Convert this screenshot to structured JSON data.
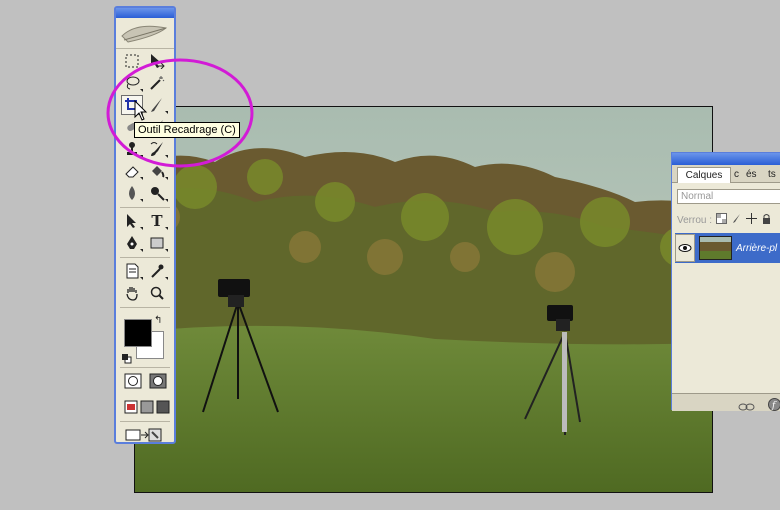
{
  "tooltip": {
    "text": "Outil Recadrage (C)"
  },
  "layers_panel": {
    "tabs": [
      "Calques",
      "c",
      "és",
      "ts"
    ],
    "blend_mode": "Normal",
    "lock_label": "Verrou :",
    "layer_name": "Arrière-pl"
  },
  "toolbox": {
    "type_tool_glyph": "T",
    "tools": [
      "marquee-tool",
      "move-tool",
      "lasso-tool",
      "magic-wand-tool",
      "crop-tool",
      "slice-tool",
      "healing-brush-tool",
      "brush-tool",
      "clone-stamp-tool",
      "history-brush-tool",
      "eraser-tool",
      "paint-bucket-tool",
      "blur-tool",
      "dodge-tool",
      "path-selection-tool",
      "type-tool",
      "pen-tool",
      "shape-tool",
      "notes-tool",
      "eyedropper-tool",
      "hand-tool",
      "zoom-tool"
    ],
    "active_tool": "crop-tool"
  },
  "colors": {
    "foreground": "#000000",
    "background": "#ffffff",
    "annotation": "#d21bd6",
    "title_bar": "#2a5ed6"
  }
}
